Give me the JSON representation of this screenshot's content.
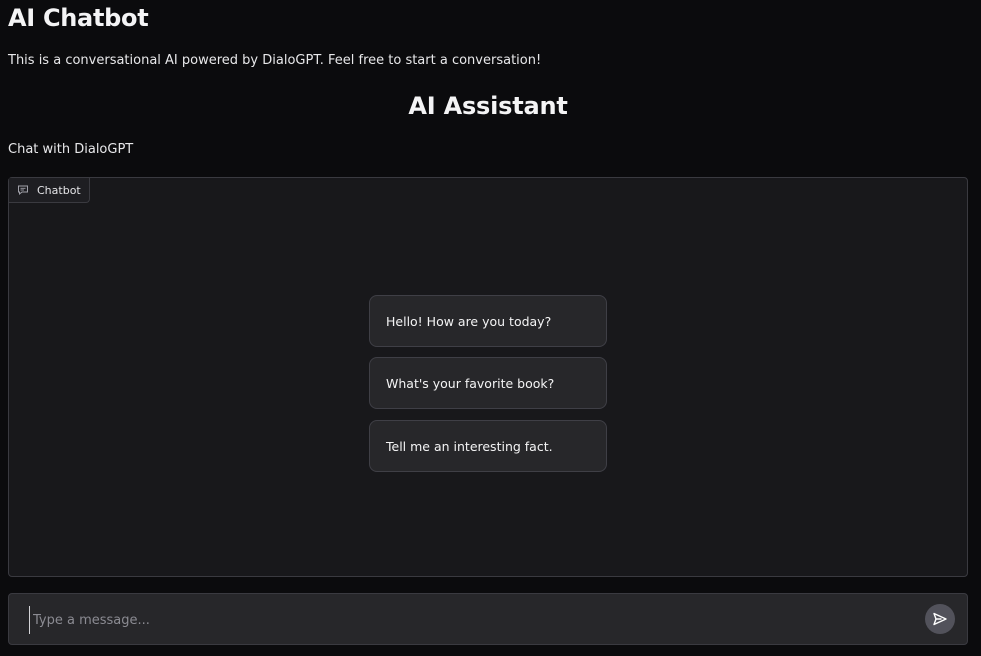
{
  "app": {
    "title": "AI Chatbot",
    "description": "This is a conversational AI powered by DialoGPT. Feel free to start a conversation!"
  },
  "assistant": {
    "title": "AI Assistant",
    "subtitle": "Chat with DialoGPT"
  },
  "chatbot": {
    "label": "Chatbot",
    "label_icon": "chat-bubble-icon",
    "examples": [
      "Hello! How are you today?",
      "What's your favorite book?",
      "Tell me an interesting fact."
    ]
  },
  "input": {
    "value": "",
    "placeholder": "Type a message...",
    "send_icon": "send-arrow-icon"
  },
  "colors": {
    "background": "#0b0b0d",
    "panel": "#18181b",
    "button": "#27272a",
    "border": "#3a3a40",
    "send_button": "#52525b",
    "text": "#f4f4f5"
  }
}
